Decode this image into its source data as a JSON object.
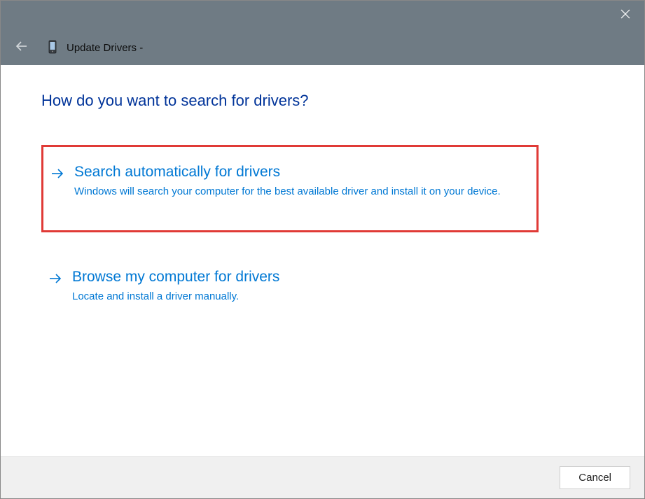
{
  "titlebar": {},
  "header": {
    "window_title": "Update Drivers -"
  },
  "main": {
    "heading": "How do you want to search for drivers?",
    "options": [
      {
        "title": "Search automatically for drivers",
        "description": "Windows will search your computer for the best available driver and install it on your device."
      },
      {
        "title": "Browse my computer for drivers",
        "description": "Locate and install a driver manually."
      }
    ]
  },
  "footer": {
    "cancel_label": "Cancel"
  }
}
